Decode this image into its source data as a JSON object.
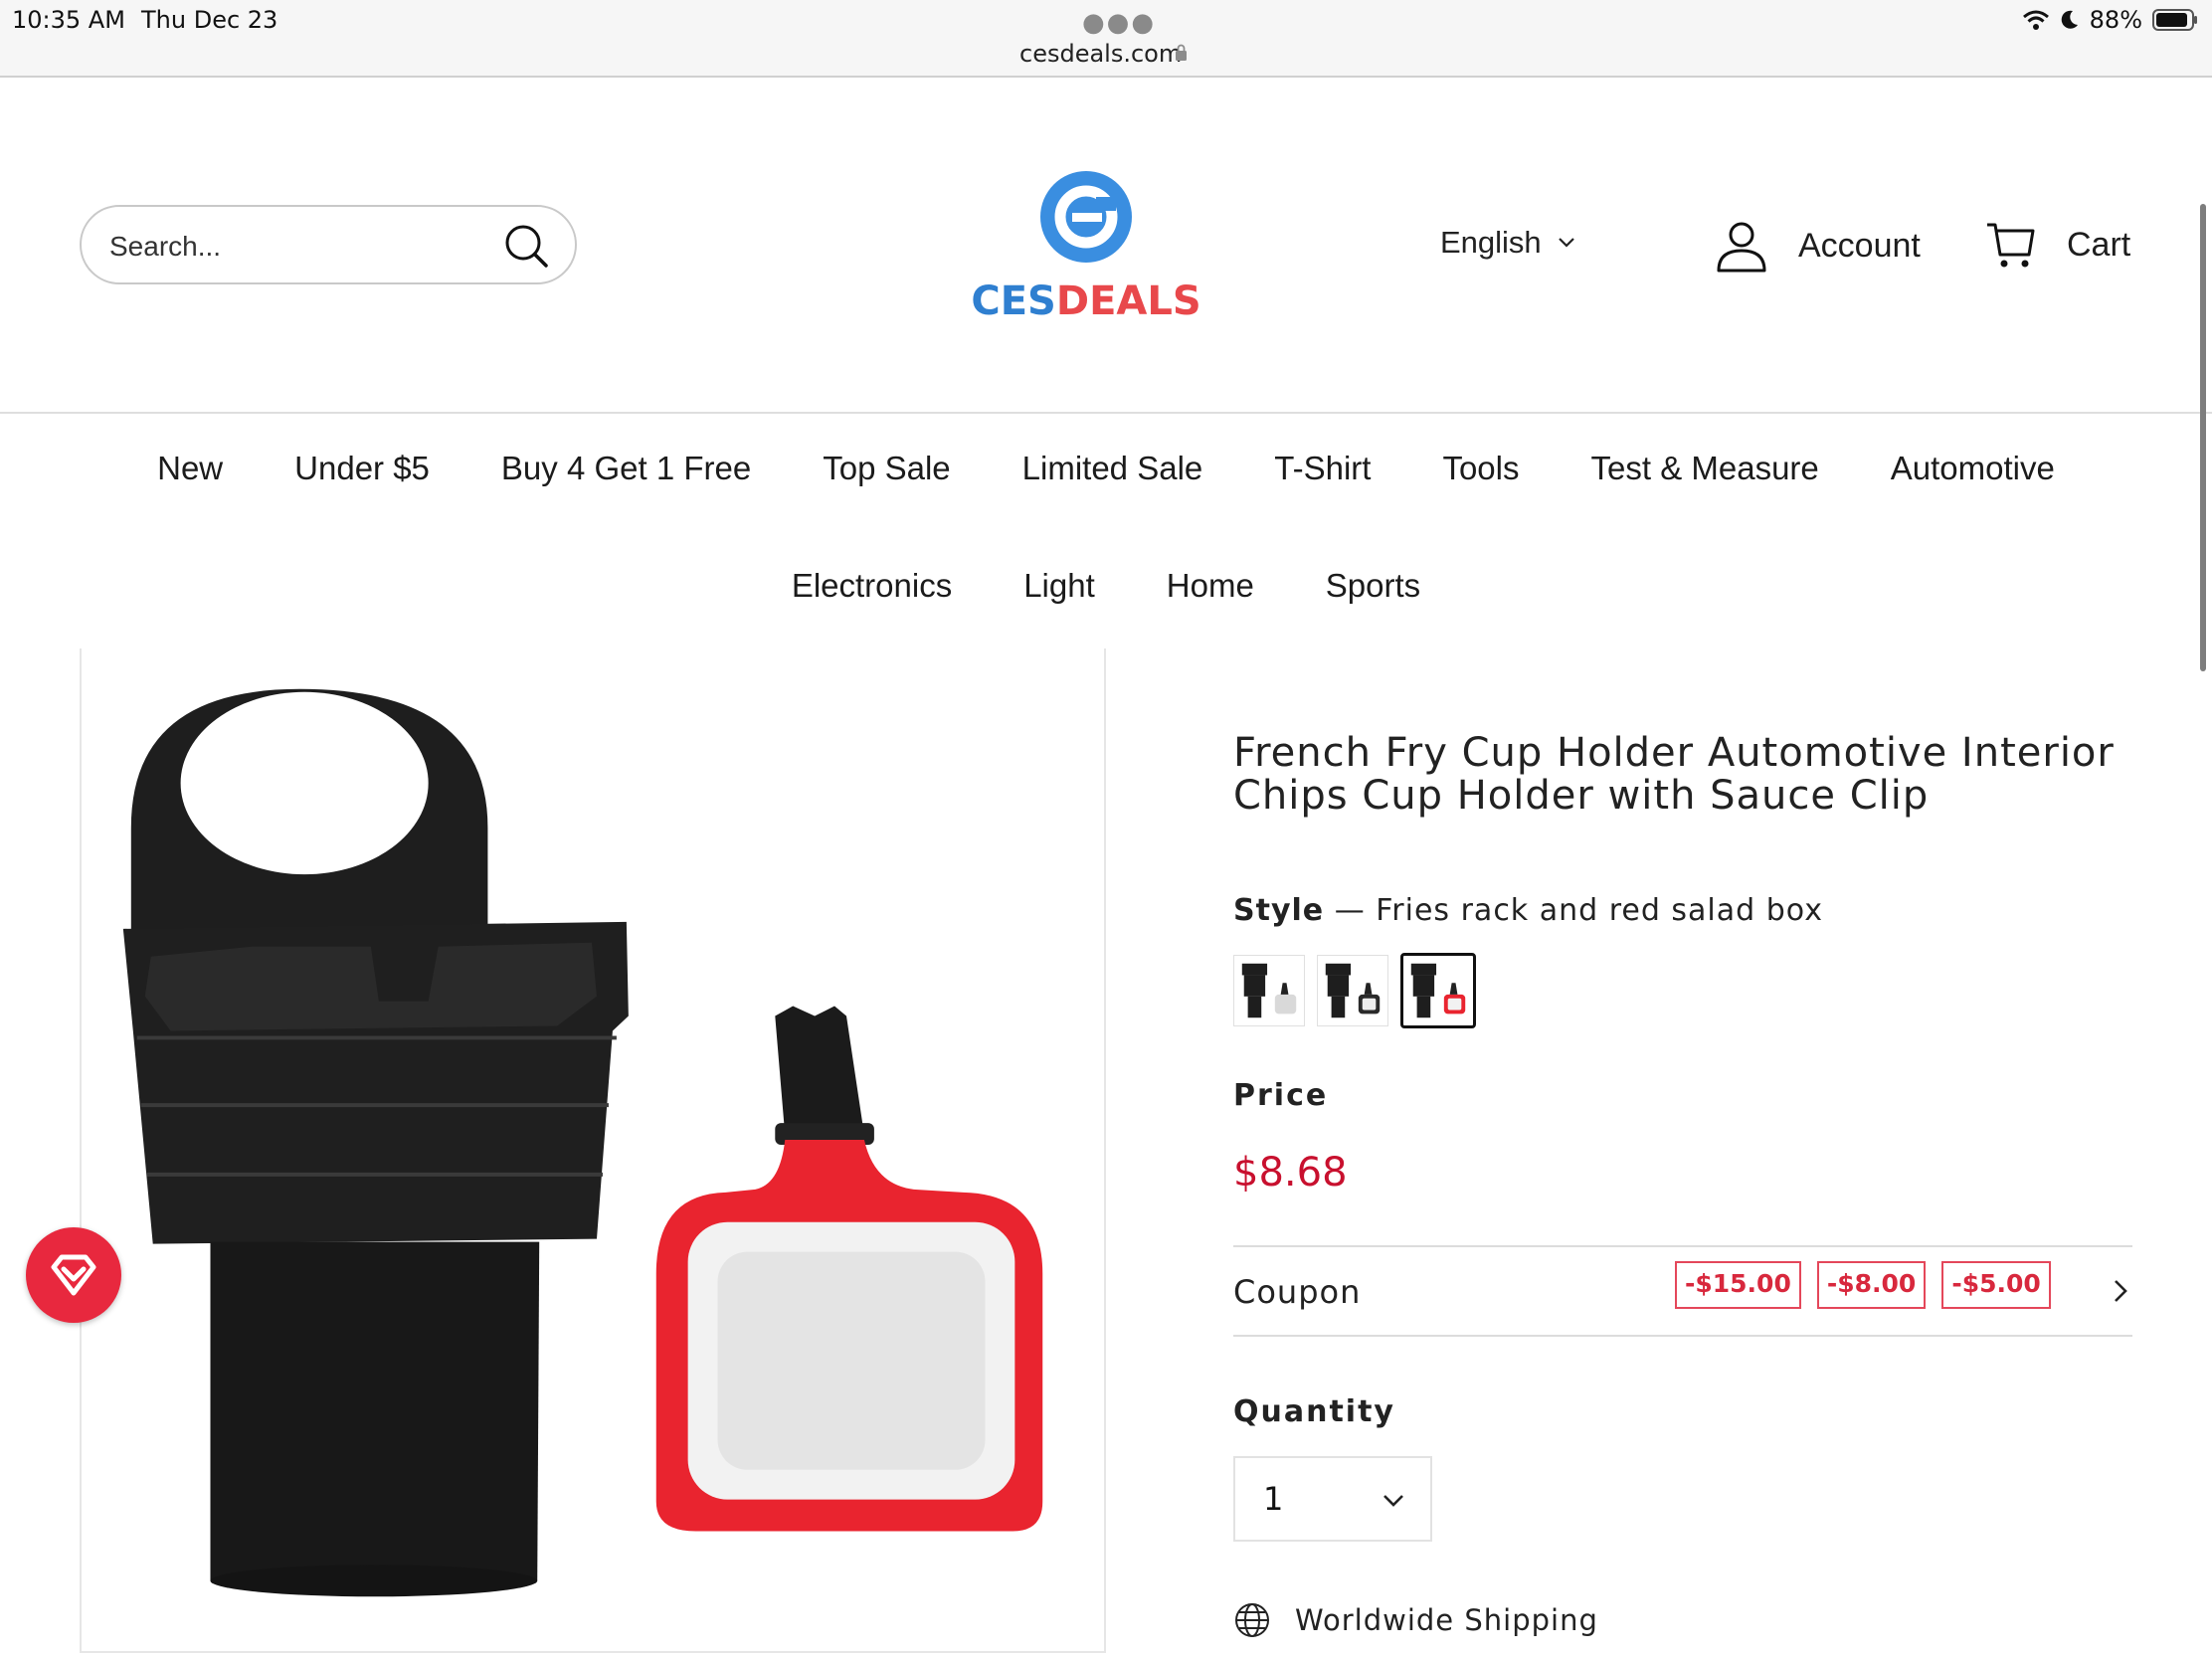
{
  "status_bar": {
    "time": "10:35 AM",
    "date": "Thu Dec 23",
    "url": "cesdeals.com",
    "battery": "88%",
    "icons": [
      "wifi-icon",
      "moon-icon",
      "battery-icon",
      "lock-icon"
    ]
  },
  "header": {
    "search_placeholder": "Search...",
    "logo_text_left": "CES",
    "logo_text_right": "DEALS",
    "language": "English",
    "account_label": "Account",
    "cart_label": "Cart"
  },
  "nav": {
    "row1": [
      "New",
      "Under $5",
      "Buy 4 Get 1 Free",
      "Top Sale",
      "Limited Sale",
      "T-Shirt",
      "Tools",
      "Test & Measure",
      "Automotive"
    ],
    "row2": [
      "Electronics",
      "Light",
      "Home",
      "Sports"
    ]
  },
  "product": {
    "title": "French Fry Cup Holder Automotive Interior Chips Cup Holder with Sauce Clip",
    "style_label": "Style",
    "style_value": "Fries rack and red salad box",
    "swatch_selected_index": 2,
    "price_label": "Price",
    "price": "$8.68",
    "coupon_label": "Coupon",
    "coupons": [
      "-$15.00",
      "-$8.00",
      "-$5.00"
    ],
    "quantity_label": "Quantity",
    "quantity_value": "1",
    "shipping_text": "Worldwide Shipping"
  },
  "colors": {
    "price_red": "#c8102e",
    "coupon_red": "#e4475a",
    "logo_blue": "#2f7fd0",
    "logo_red": "#e8484b",
    "fav_badge": "#e8283e"
  }
}
